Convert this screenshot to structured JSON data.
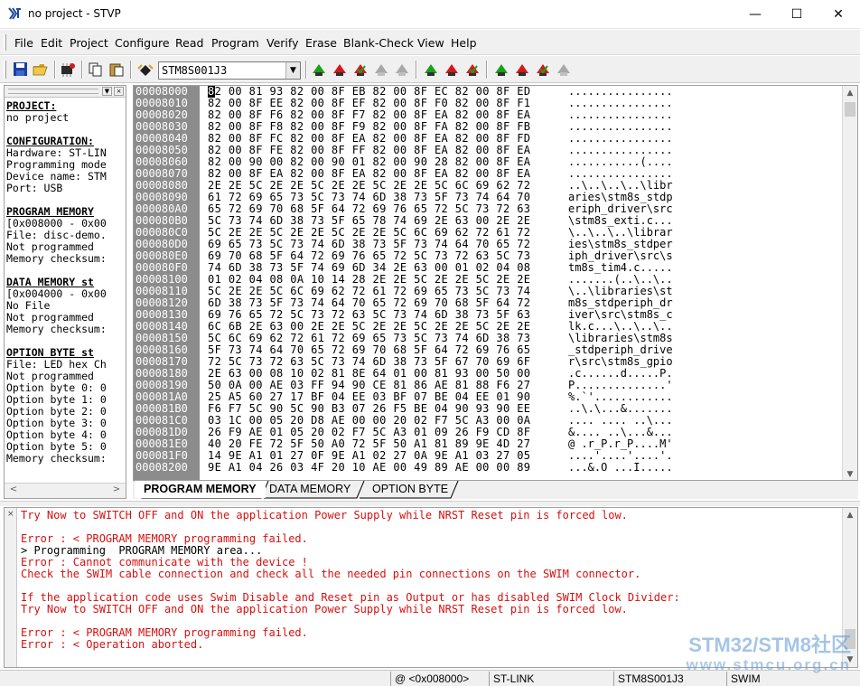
{
  "window": {
    "title": "no project - STVP",
    "controls": {
      "minimize": "—",
      "maximize": "☐",
      "close": "✕"
    }
  },
  "menu": {
    "items": [
      {
        "label": "File"
      },
      {
        "label": "Edit"
      },
      {
        "label": "Project"
      },
      {
        "label": "Configure"
      },
      {
        "label": "Read"
      },
      {
        "label": "Program"
      },
      {
        "label": "Verify"
      },
      {
        "label": "Erase"
      },
      {
        "label": "Blank-Check"
      },
      {
        "label": "View"
      },
      {
        "label": "Help"
      }
    ]
  },
  "toolbar": {
    "device_selected": "STM8S001J3",
    "colors": {
      "green": "#1aa01a",
      "red": "#d21a1a",
      "gray": "#a8a8a8",
      "dark": "#303030"
    }
  },
  "left_panel": {
    "lines": [
      {
        "text": "PROJECT:",
        "head": true
      },
      {
        "text": "no project",
        "head": false
      },
      {
        "text": "",
        "head": false
      },
      {
        "text": "CONFIGURATION:",
        "head": true
      },
      {
        "text": "Hardware: ST-LIN",
        "head": false
      },
      {
        "text": "Programming mode",
        "head": false
      },
      {
        "text": "Device name: STM",
        "head": false
      },
      {
        "text": "Port: USB",
        "head": false
      },
      {
        "text": "",
        "head": false
      },
      {
        "text": "PROGRAM MEMORY",
        "head": true
      },
      {
        "text": "[0x008000 - 0x00",
        "head": false
      },
      {
        "text": "File: disc-demo.",
        "head": false
      },
      {
        "text": "Not programmed",
        "head": false
      },
      {
        "text": "Memory checksum:",
        "head": false
      },
      {
        "text": "",
        "head": false
      },
      {
        "text": "DATA MEMORY st",
        "head": true
      },
      {
        "text": "[0x004000 - 0x00",
        "head": false
      },
      {
        "text": "No File",
        "head": false
      },
      {
        "text": "Not programmed",
        "head": false
      },
      {
        "text": "Memory checksum:",
        "head": false
      },
      {
        "text": "",
        "head": false
      },
      {
        "text": "OPTION BYTE st",
        "head": true
      },
      {
        "text": "File: LED hex Ch",
        "head": false
      },
      {
        "text": "Not programmed",
        "head": false
      },
      {
        "text": "Option byte 0: 0",
        "head": false
      },
      {
        "text": "Option byte 1: 0",
        "head": false
      },
      {
        "text": "Option byte 2: 0",
        "head": false
      },
      {
        "text": "Option byte 3: 0",
        "head": false
      },
      {
        "text": "Option byte 4: 0",
        "head": false
      },
      {
        "text": "Option byte 5: 0",
        "head": false
      },
      {
        "text": "Memory checksum:",
        "head": false
      }
    ]
  },
  "hex_view": {
    "rows": [
      {
        "addr": "00008000",
        "bytes": "82 00 81 93 82 00 8F EB 82 00 8F EC 82 00 8F ED",
        "ascii": "................"
      },
      {
        "addr": "00008010",
        "bytes": "82 00 8F EE 82 00 8F EF 82 00 8F F0 82 00 8F F1",
        "ascii": "................"
      },
      {
        "addr": "00008020",
        "bytes": "82 00 8F F6 82 00 8F F7 82 00 8F EA 82 00 8F EA",
        "ascii": "................"
      },
      {
        "addr": "00008030",
        "bytes": "82 00 8F F8 82 00 8F F9 82 00 8F FA 82 00 8F FB",
        "ascii": "................"
      },
      {
        "addr": "00008040",
        "bytes": "82 00 8F FC 82 00 8F EA 82 00 8F EA 82 00 8F FD",
        "ascii": "................"
      },
      {
        "addr": "00008050",
        "bytes": "82 00 8F FE 82 00 8F FF 82 00 8F EA 82 00 8F EA",
        "ascii": "................"
      },
      {
        "addr": "00008060",
        "bytes": "82 00 90 00 82 00 90 01 82 00 90 28 82 00 8F EA",
        "ascii": "...........(...."
      },
      {
        "addr": "00008070",
        "bytes": "82 00 8F EA 82 00 8F EA 82 00 8F EA 82 00 8F EA",
        "ascii": "................"
      },
      {
        "addr": "00008080",
        "bytes": "2E 2E 5C 2E 2E 5C 2E 2E 5C 2E 2E 5C 6C 69 62 72",
        "ascii": "..\\..\\..\\..\\libr"
      },
      {
        "addr": "00008090",
        "bytes": "61 72 69 65 73 5C 73 74 6D 38 73 5F 73 74 64 70",
        "ascii": "aries\\stm8s_stdp"
      },
      {
        "addr": "000080A0",
        "bytes": "65 72 69 70 68 5F 64 72 69 76 65 72 5C 73 72 63",
        "ascii": "eriph_driver\\src"
      },
      {
        "addr": "000080B0",
        "bytes": "5C 73 74 6D 38 73 5F 65 78 74 69 2E 63 00 2E 2E",
        "ascii": "\\stm8s_exti.c..."
      },
      {
        "addr": "000080C0",
        "bytes": "5C 2E 2E 5C 2E 2E 5C 2E 2E 5C 6C 69 62 72 61 72",
        "ascii": "\\..\\..\\..\\librar"
      },
      {
        "addr": "000080D0",
        "bytes": "69 65 73 5C 73 74 6D 38 73 5F 73 74 64 70 65 72",
        "ascii": "ies\\stm8s_stdper"
      },
      {
        "addr": "000080E0",
        "bytes": "69 70 68 5F 64 72 69 76 65 72 5C 73 72 63 5C 73",
        "ascii": "iph_driver\\src\\s"
      },
      {
        "addr": "000080F0",
        "bytes": "74 6D 38 73 5F 74 69 6D 34 2E 63 00 01 02 04 08",
        "ascii": "tm8s_tim4.c....."
      },
      {
        "addr": "00008100",
        "bytes": "01 02 04 08 0A 10 14 28 2E 2E 5C 2E 2E 5C 2E 2E",
        "ascii": ".......(..\\..\\.."
      },
      {
        "addr": "00008110",
        "bytes": "5C 2E 2E 5C 6C 69 62 72 61 72 69 65 73 5C 73 74",
        "ascii": "\\..\\libraries\\st"
      },
      {
        "addr": "00008120",
        "bytes": "6D 38 73 5F 73 74 64 70 65 72 69 70 68 5F 64 72",
        "ascii": "m8s_stdperiph_dr"
      },
      {
        "addr": "00008130",
        "bytes": "69 76 65 72 5C 73 72 63 5C 73 74 6D 38 73 5F 63",
        "ascii": "iver\\src\\stm8s_c"
      },
      {
        "addr": "00008140",
        "bytes": "6C 6B 2E 63 00 2E 2E 5C 2E 2E 5C 2E 2E 5C 2E 2E",
        "ascii": "lk.c...\\..\\..\\.."
      },
      {
        "addr": "00008150",
        "bytes": "5C 6C 69 62 72 61 72 69 65 73 5C 73 74 6D 38 73",
        "ascii": "\\libraries\\stm8s"
      },
      {
        "addr": "00008160",
        "bytes": "5F 73 74 64 70 65 72 69 70 68 5F 64 72 69 76 65",
        "ascii": "_stdperiph_drive"
      },
      {
        "addr": "00008170",
        "bytes": "72 5C 73 72 63 5C 73 74 6D 38 73 5F 67 70 69 6F",
        "ascii": "r\\src\\stm8s_gpio"
      },
      {
        "addr": "00008180",
        "bytes": "2E 63 00 08 10 02 81 8E 64 01 00 81 93 00 50 00",
        "ascii": ".c......d.....P."
      },
      {
        "addr": "00008190",
        "bytes": "50 0A 00 AE 03 FF 94 90 CE 81 86 AE 81 88 F6 27",
        "ascii": "P..............'"
      },
      {
        "addr": "000081A0",
        "bytes": "25 A5 60 27 17 BF 04 EE 03 BF 07 BE 04 EE 01 90",
        "ascii": "%.`'............"
      },
      {
        "addr": "000081B0",
        "bytes": "F6 F7 5C 90 5C 90 B3 07 26 F5 BE 04 90 93 90 EE",
        "ascii": "..\\.\\...&......."
      },
      {
        "addr": "000081C0",
        "bytes": "03 1C 00 05 20 D8 AE 00 00 20 02 F7 5C A3 00 0A",
        "ascii": ".... .... ..\\..."
      },
      {
        "addr": "000081D0",
        "bytes": "26 F9 AE 01 05 20 02 F7 5C A3 01 09 26 F9 CD 8F",
        "ascii": "&.... ..\\...&..."
      },
      {
        "addr": "000081E0",
        "bytes": "40 20 FE 72 5F 50 A0 72 5F 50 A1 81 89 9E 4D 27",
        "ascii": "@ .r_P.r_P....M'"
      },
      {
        "addr": "000081F0",
        "bytes": "14 9E A1 01 27 0F 9E A1 02 27 0A 9E A1 03 27 05",
        "ascii": "....'....'....'."
      },
      {
        "addr": "00008200",
        "bytes": "9E A1 04 26 03 4F 20 10 AE 00 49 89 AE 00 00 89",
        "ascii": "...&.O ...I....."
      }
    ]
  },
  "tabs": [
    {
      "label": "PROGRAM MEMORY",
      "active": true
    },
    {
      "label": "DATA MEMORY",
      "active": false
    },
    {
      "label": "OPTION BYTE",
      "active": false
    }
  ],
  "log": {
    "lines": [
      {
        "text": "Try Now to SWITCH OFF and ON the application Power Supply while NRST Reset pin is forced low.",
        "color": "red"
      },
      {
        "text": "",
        "color": "red"
      },
      {
        "text": "Error : < PROGRAM MEMORY programming failed.",
        "color": "red"
      },
      {
        "text": "> Programming  PROGRAM MEMORY area...",
        "color": "black"
      },
      {
        "text": "Error : Cannot communicate with the device !",
        "color": "red"
      },
      {
        "text": "Check the SWIM cable connection and check all the needed pin connections on the SWIM connector.",
        "color": "red"
      },
      {
        "text": "",
        "color": "red"
      },
      {
        "text": "If the application code uses Swim Disable and Reset pin as Output or has disabled SWIM Clock Divider:",
        "color": "red"
      },
      {
        "text": "Try Now to SWITCH OFF and ON the application Power Supply while NRST Reset pin is forced low.",
        "color": "red"
      },
      {
        "text": "",
        "color": "red"
      },
      {
        "text": "Error : < PROGRAM MEMORY programming failed.",
        "color": "red"
      },
      {
        "text": "Error : < Operation aborted.",
        "color": "red"
      }
    ]
  },
  "status": {
    "address": "@ <0x008000>",
    "hardware": "ST-LINK",
    "device": "STM8S001J3",
    "protocol": "SWIM"
  },
  "watermark": {
    "line1": "STM32/STM8社区",
    "line2": "www.stmcu.org.cn"
  }
}
